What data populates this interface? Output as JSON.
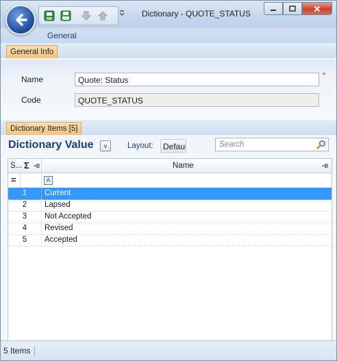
{
  "window": {
    "title": "Dictionary - QUOTE_STATUS"
  },
  "ribbon": {
    "tab_general": "General"
  },
  "general_info": {
    "section_label": "General Info",
    "name_label": "Name",
    "name_value": "Quote: Status",
    "code_label": "Code",
    "code_value": "QUOTE_STATUS",
    "required_marker": "*"
  },
  "dictionary_items": {
    "section_label": "Dictionary Items [5]",
    "title": "Dictionary Value",
    "view_button": "v",
    "layout_label": "Layout:",
    "layout_value": "Default",
    "search_placeholder": "Search"
  },
  "grid": {
    "columns": {
      "sort": "S...",
      "sum": "Σ",
      "name": "Name"
    },
    "filter_eq": "=",
    "filter_a": "A",
    "rows": [
      {
        "num": "1",
        "name": "Current",
        "selected": true
      },
      {
        "num": "2",
        "name": "Lapsed",
        "selected": false
      },
      {
        "num": "3",
        "name": "Not Accepted",
        "selected": false
      },
      {
        "num": "4",
        "name": "Revised",
        "selected": false
      },
      {
        "num": "5",
        "name": "Accepted",
        "selected": false
      }
    ]
  },
  "status": {
    "items_count": "5 Items"
  },
  "colors": {
    "selection": "#3399ff",
    "title_text": "#1e3d7b",
    "section_tab": "#f5c277"
  }
}
